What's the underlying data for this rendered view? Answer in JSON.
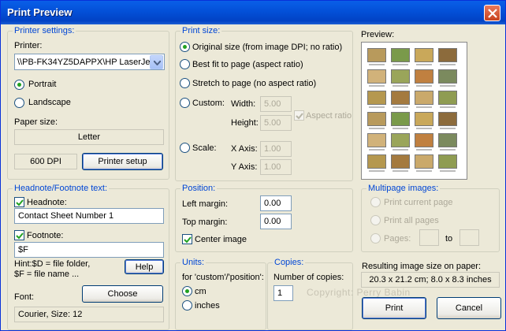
{
  "window": {
    "title": "Print Preview"
  },
  "printer_settings": {
    "legend": "Printer settings:",
    "printer_label": "Printer:",
    "printer_value": "\\\\PB-FK34YZ5DAPPX\\HP LaserJe",
    "portrait": "Portrait",
    "landscape": "Landscape",
    "paper_size_label": "Paper size:",
    "paper_size": "Letter",
    "dpi": "600 DPI",
    "setup_button": "Printer setup"
  },
  "print_size": {
    "legend": "Print size:",
    "original": "Original size (from image DPI; no ratio)",
    "best_fit": "Best fit to page (aspect ratio)",
    "stretch": "Stretch to page (no aspect ratio)",
    "custom": "Custom:",
    "width_label": "Width:",
    "width_value": "5.00",
    "height_label": "Height:",
    "height_value": "5.00",
    "aspect_ratio": "Aspect ratio",
    "scale": "Scale:",
    "xaxis_label": "X Axis:",
    "xaxis_value": "1.00",
    "yaxis_label": "Y Axis:",
    "yaxis_value": "1.00"
  },
  "preview": {
    "label": "Preview:"
  },
  "headnote": {
    "legend": "Headnote/Footnote text:",
    "headnote_label": "Headnote:",
    "headnote_value": "Contact Sheet Number 1",
    "footnote_label": "Footnote:",
    "footnote_value": "$F",
    "hint_line1": "Hint:$D = file folder,",
    "hint_line2": "$F = file name ...",
    "help_button": "Help",
    "font_label": "Font:",
    "choose_button": "Choose",
    "font_value": "Courier, Size: 12"
  },
  "position": {
    "legend": "Position:",
    "left_label": "Left margin:",
    "left_value": "0.00",
    "top_label": "Top margin:",
    "top_value": "0.00",
    "center": "Center image"
  },
  "multipage": {
    "legend": "Multipage images:",
    "current": "Print current page",
    "all": "Print all pages",
    "pages": "Pages:",
    "to": "to"
  },
  "units": {
    "legend": "Units:",
    "note": "for 'custom'/'position':",
    "cm": "cm",
    "inches": "inches"
  },
  "copies": {
    "legend": "Copies:",
    "label": "Number of copies:",
    "value": "1"
  },
  "copyright": "Copyright: Perry Babin",
  "result": {
    "label": "Resulting image size on paper:",
    "value": "20.3 x 21.2 cm; 8.0 x 8.3 inches"
  },
  "actions": {
    "print": "Print",
    "cancel": "Cancel"
  }
}
